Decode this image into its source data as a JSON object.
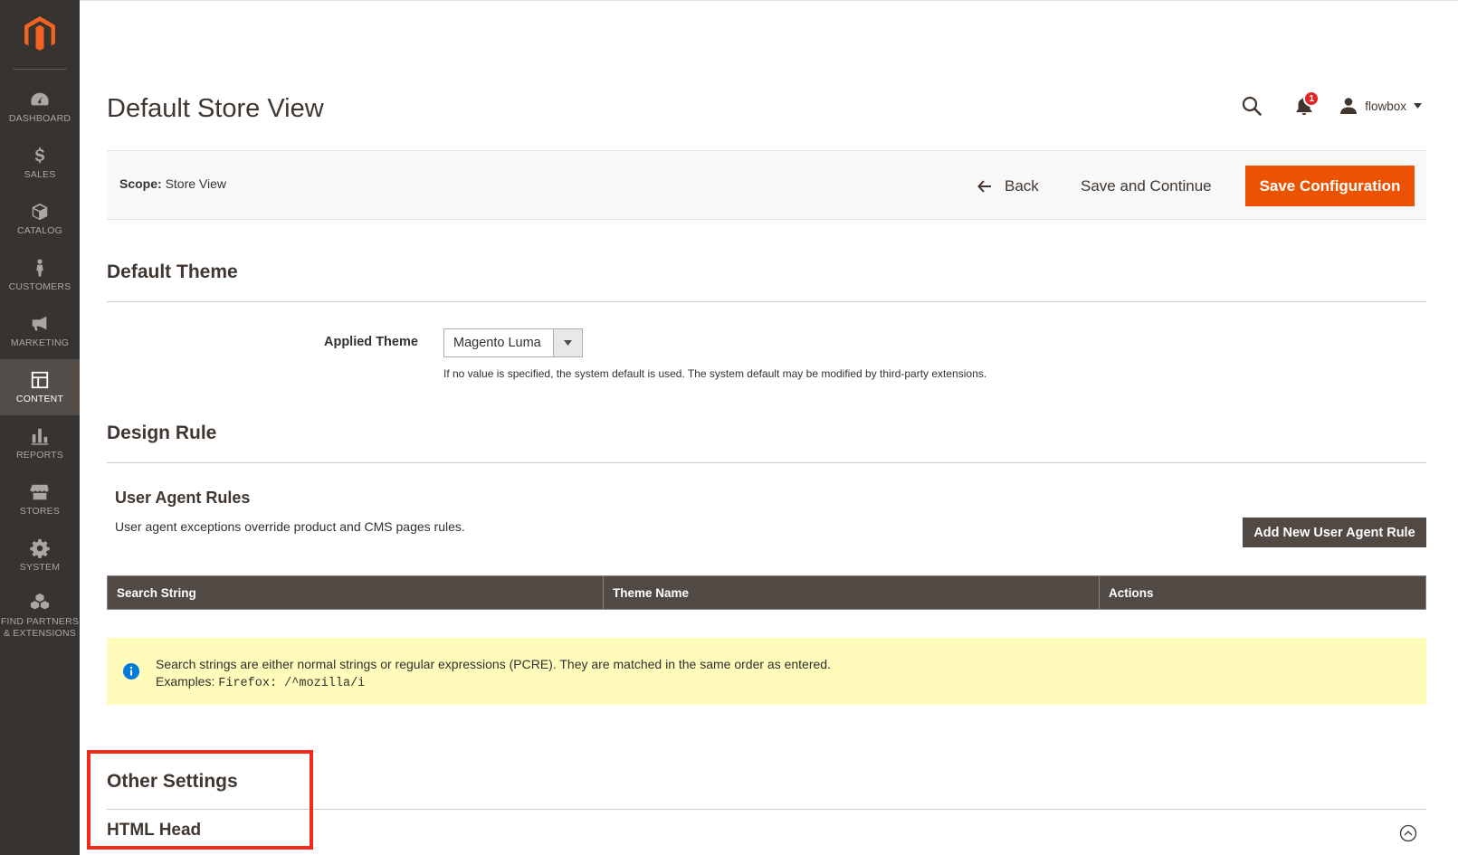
{
  "sidebar": {
    "items": [
      {
        "label": "DASHBOARD",
        "icon": "dashboard-icon"
      },
      {
        "label": "SALES",
        "icon": "dollar-icon"
      },
      {
        "label": "CATALOG",
        "icon": "cube-icon"
      },
      {
        "label": "CUSTOMERS",
        "icon": "person-icon"
      },
      {
        "label": "MARKETING",
        "icon": "megaphone-icon"
      },
      {
        "label": "CONTENT",
        "icon": "layout-icon"
      },
      {
        "label": "REPORTS",
        "icon": "bar-chart-icon"
      },
      {
        "label": "STORES",
        "icon": "storefront-icon"
      },
      {
        "label": "SYSTEM",
        "icon": "gear-icon"
      },
      {
        "label_line1": "FIND PARTNERS",
        "label_line2": "& EXTENSIONS",
        "icon": "boxes-icon"
      }
    ],
    "active": "CONTENT"
  },
  "header": {
    "title": "Default Store View",
    "notifications_count": "1",
    "user_name": "flowbox"
  },
  "action_bar": {
    "scope_label": "Scope:",
    "scope_value": "Store View",
    "back_label": "Back",
    "save_continue_label": "Save and Continue",
    "save_config_label": "Save Configuration"
  },
  "default_theme": {
    "title": "Default Theme",
    "field_label": "Applied Theme",
    "selected_value": "Magento Luma",
    "note": "If no value is specified, the system default is used. The system default may be modified by third-party extensions."
  },
  "design_rule": {
    "title": "Design Rule",
    "subsection_title": "User Agent Rules",
    "subsection_desc": "User agent exceptions override product and CMS pages rules.",
    "add_button_label": "Add New User Agent Rule",
    "columns": [
      "Search String",
      "Theme Name",
      "Actions"
    ],
    "info_line1": "Search strings are either normal strings or regular expressions (PCRE). They are matched in the same order as entered.",
    "info_examples_label": "Examples:",
    "info_examples_code": "Firefox: /^mozilla/i"
  },
  "other_settings": {
    "title": "Other Settings",
    "html_head": "HTML Head"
  },
  "colors": {
    "accent": "#eb5202",
    "sidebar_bg": "#373330",
    "grid_header": "#514943",
    "highlight": "#f52a1c",
    "info_bg": "#fffbbb"
  }
}
